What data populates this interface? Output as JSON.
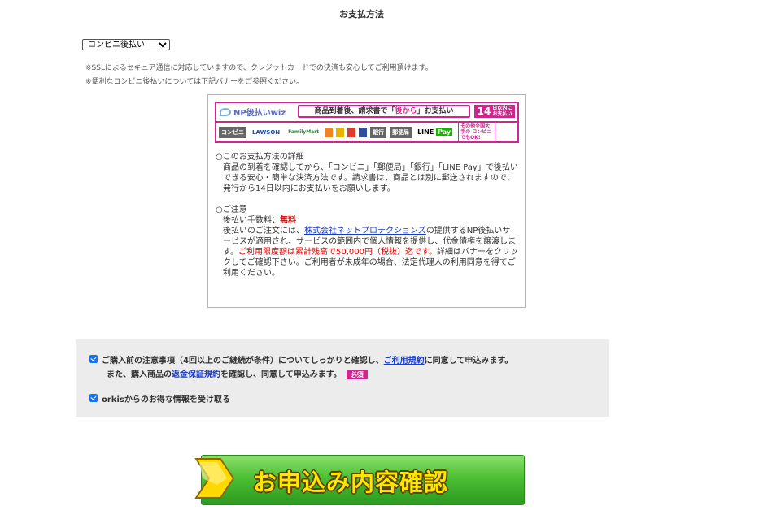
{
  "title": "お支払方法",
  "payment_select": {
    "selected": "コンビニ後払い"
  },
  "notes": [
    "※SSLによるセキュア通信に対応していますので、クレジットカードでの決済も安心してご利用頂けます。",
    "※便利なコンビニ後払いについては下記バナーをご参照ください。"
  ],
  "banner": {
    "logo": "NP後払いwiz",
    "msg_a": "商品到着後、請求書で「",
    "msg_b": "後から",
    "msg_c": "」お支払い",
    "days_num": "14",
    "days_text": "日以内に お支払い",
    "chips": [
      "コンビニ",
      "LAWSON",
      "FamilyMart",
      "銀行",
      "郵便局",
      "LINE",
      "Pay",
      "その他全国大手の コンビニでもOK!"
    ],
    "colors": {
      "brand": "#d0258f"
    }
  },
  "details": {
    "heading1": "○このお支払方法の詳細",
    "body1": "商品の到着を確認してから、「コンビニ」「郵便局」「銀行」「LINE Pay」で後払いできる安心・簡単な決済方法です。請求書は、商品とは別に郵送されますので、発行から14日以内にお支払いをお願いします。",
    "heading2": "○ご注意",
    "fee_label": "後払い手数料：",
    "fee_value": "無料",
    "body2_a": "後払いのご注文には、",
    "body2_link": "株式会社ネットプロテクションズ",
    "body2_b": "の提供するNP後払いサービスが適用され、サービスの範囲内で個人情報を提供し、代金債権を譲渡します。",
    "body2_red": "ご利用限度額は累計残高で50,000円（税抜）迄です。",
    "body2_c": "詳細はバナーをクリックしてご確認下さい。ご利用者が未成年の場合、法定代理人の利用同意を得てご利用ください。"
  },
  "consent": {
    "line1_a": "ご購入前の注意事項（4回以上のご継続が条件）についてしっかりと確認し、",
    "line1_link": "ご利用規約",
    "line1_b": "に同意して申込みます。",
    "line2_a": "また、購入商品の",
    "line2_link": "返金保証規約",
    "line2_b": "を確認し、同意して申込みます。",
    "required": "必須",
    "newsletter": "orkisからのお得な情報を受け取る"
  },
  "submit": {
    "label": "お申込み内容確認"
  }
}
